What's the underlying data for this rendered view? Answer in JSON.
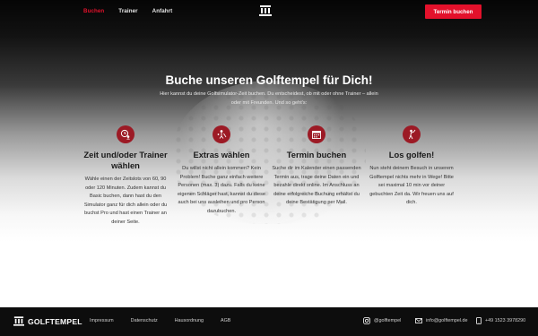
{
  "nav": {
    "items": [
      {
        "label": "Buchen",
        "active": true
      },
      {
        "label": "Trainer",
        "active": false
      },
      {
        "label": "Anfahrt",
        "active": false
      }
    ],
    "cta_label": "Termin buchen"
  },
  "hero": {
    "title": "Buche unseren Golftempel für Dich!",
    "subtitle": "Hier kannst du deine Golfsimulator-Zeit buchen. Du entscheidest, ob mit oder ohne Trainer – allein oder mit Freunden. Und so geht's:"
  },
  "features": [
    {
      "icon": "clock-user-icon",
      "title": "Zeit und/oder Trainer wählen",
      "text": "Wähle einen der Zeitslots von 60, 90 oder 120 Minuten. Zudem kannst du Basic buchen, dann hast du den Simulator ganz für dich allein oder du buchst Pro und hast einen Trainer an deiner Seite."
    },
    {
      "icon": "golf-extras-icon",
      "title": "Extras wählen",
      "text": "Du willst nicht allein kommen? Kein Problem! Buche ganz einfach weitere Personen (max. 3) dazu. Falls du keine eigenen Schläger hast, kannst du diese auch bei uns ausleihen und pro Person dazubuchen."
    },
    {
      "icon": "calendar-icon",
      "title": "Termin buchen",
      "text": "Suche dir im Kalender einen passenden Termin aus, trage deine Daten ein und bezahle direkt online. Im Anschluss an deine erfolgreiche Buchung erhältst du deine Bestätigung per Mail."
    },
    {
      "icon": "golfer-icon",
      "title": "Los golfen!",
      "text": "Nun steht deinem Besuch in unserem Golftempel nichts mehr in Wege! Bitte sei maximal 10 min vor deiner gebuchten Zeit da. Wir freuen uns auf dich."
    }
  ],
  "footer": {
    "brand": "GOLFTEMPEL",
    "links": [
      "Impressum",
      "Datenschutz",
      "Hausordnung",
      "AGB"
    ],
    "instagram": "@golftempel",
    "email": "info@golftempel.de",
    "phone": "+49 1523 3978290"
  },
  "colors": {
    "accent": "#e3112b",
    "icon_bg": "#9c1a25",
    "footer_bg": "#0d0d0d"
  }
}
